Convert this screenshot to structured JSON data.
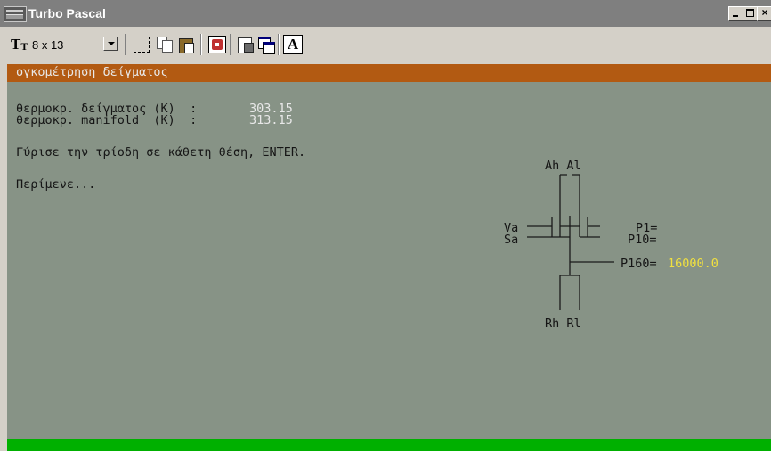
{
  "window": {
    "title": "Turbo Pascal",
    "icon": "ms-dos-icon",
    "buttons": [
      "minimize",
      "maximize",
      "close"
    ]
  },
  "toolbar": {
    "tt_glyph": "T",
    "font_size_label": "8 x 13",
    "icons": [
      "mark-icon",
      "copy-icon",
      "paste-icon",
      "fullscreen-icon",
      "properties-icon",
      "background-icon",
      "font-icon"
    ],
    "font_button_label": "A"
  },
  "console": {
    "header": "ογκομέτρηση δείγματος",
    "rows": [
      {
        "label": "θερμοκρ. δείγματος (K)  :",
        "value": "303.15"
      },
      {
        "label": "θερμοκρ. manifold  (K)  :",
        "value": "313.15"
      }
    ],
    "instruction": "Γύρισε την τρίοδη σε κάθετη θέση, ENTER.",
    "waiting": "Περίμενε...",
    "diagram": {
      "top_labels": "Ah Al",
      "bottom_labels": "Rh Rl",
      "left_labels": [
        "Va",
        "Sa"
      ],
      "p1_label": "P1=",
      "p10_label": "P10=",
      "p160_label": "P160=",
      "p160_value": "16000.0"
    }
  },
  "colors": {
    "console_bg": "#879386",
    "header_bar": "#b25a12",
    "status_bar": "#00b000",
    "value_text": "#e8e8e8",
    "highlight_value": "#f0e040"
  }
}
